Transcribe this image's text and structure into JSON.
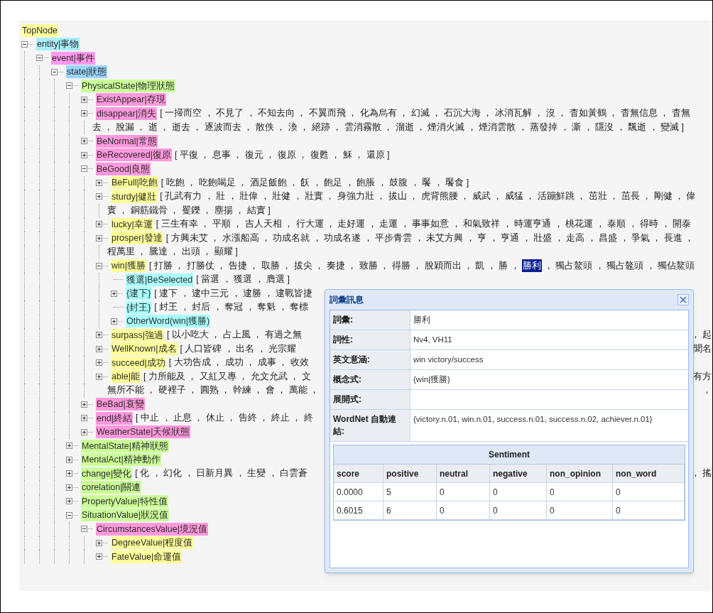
{
  "tree": {
    "label": "TopNode",
    "color": "#ffff99",
    "children": [
      {
        "label": "entity|事物",
        "color": "#a8f0ff",
        "expanded": true,
        "children": [
          {
            "label": "event|事件",
            "color": "#ff99ee",
            "expanded": true,
            "children": [
              {
                "label": "state|狀態",
                "color": "#99d6ff",
                "expanded": true,
                "children": [
                  {
                    "label": "PhysicalState|物理狀態",
                    "color": "#ccff99",
                    "expanded": true,
                    "children": [
                      {
                        "label": "ExistAppear|存現",
                        "color": "#ff99dd",
                        "expanded": false
                      },
                      {
                        "label": "disappear|消失",
                        "color": "#ff99dd",
                        "expanded": false,
                        "lines": [
                          "[ 一掃而空 ， 不見了 ， 不知去向 ， 不翼而飛 ， 化為烏有 ， 幻滅 ， 石沉大海 ， 冰消瓦解 ， 沒 ， 杳如黃鶴 ， 杳無信息 ， 杳無",
                          "去 ， 脫漏 ， 逝 ， 逝去 ， 逐波而去 ， 散佚 ， 渙 ， 絕跡 ， 雲消霧散 ， 溜逝 ， 煙消火滅 ， 煙消雲散 ， 蒸發掉 ， 澌 ， 隱沒 ， 飄逝 ， 變滅 ]"
                        ]
                      },
                      {
                        "label": "BeNormal|常態",
                        "color": "#ff99dd",
                        "expanded": false
                      },
                      {
                        "label": "BeRecovered|復原",
                        "color": "#ff99dd",
                        "expanded": false,
                        "lines": [
                          "[ 平復 ， 息事 ， 復元 ， 復原 ， 復甦 ， 穌 ， 還原 ]"
                        ]
                      },
                      {
                        "label": "BeGood|良態",
                        "color": "#ff99dd",
                        "expanded": true,
                        "children": [
                          {
                            "label": "BeFull|吃飽",
                            "color": "#ffff99",
                            "expanded": false,
                            "lines": [
                              "[ 吃飽 ， 吃飽喝足 ， 酒足飯飽 ， 飫 ， 飽足 ， 飽脹 ， 鼓腹 ， 饜 ， 饜食 ]"
                            ]
                          },
                          {
                            "label": "sturdy|健壯",
                            "color": "#ffff99",
                            "expanded": false,
                            "lines": [
                              "[ 孔武有力 ， 壯 ， 壯偉 ， 壯健 ， 壯實 ， 身強力壯 ， 拔山 ， 虎背熊腰 ， 威武 ， 威猛 ， 活蹦鮮跳 ， 茁壯 ， 茁長 ， 剛健 ， 偉",
                              "實 ， 銅筋鐵骨 ， 矍鑠 ， 塵揚 ， 結實 ]"
                            ]
                          },
                          {
                            "label": "lucky|幸運",
                            "color": "#ffff99",
                            "expanded": false,
                            "lines": [
                              "[ 三生有幸 ， 平順 ， 吉人天相 ， 行大運 ， 走好運 ， 走運 ， 事事如意 ， 和氣致祥 ， 時運亨通 ， 桃花運 ， 泰順 ， 得時 ， 開泰"
                            ]
                          },
                          {
                            "label": "prosper|發達",
                            "color": "#ffff99",
                            "expanded": false,
                            "lines": [
                              "[ 方興未艾 ， 水漲船高 ， 功成名就 ， 功成名遂 ， 平步青雲 ， 未艾方興 ， 亨 ， 亨通 ， 壯盛 ， 走高 ， 昌盛 ， 爭氣 ， 長進 ，",
                              "程萬里 ， 騰達 ， 出頭 ， 顯耀 ]"
                            ]
                          },
                          {
                            "label": "win|獲勝",
                            "color": "#ffff99",
                            "expanded": true,
                            "segments": [
                              {
                                "text": "[ 打勝 ， 打勝仗 ， 告捷 ， 取勝 ， 拔尖 ， 奏捷 ， 致勝 ， 得勝 ， 脫穎而出 ， 凱 ， 勝 ，",
                                "selected": false
                              },
                              {
                                "text": "勝利",
                                "selected": true
                              },
                              {
                                "text": "， 獨占鰲頭 ， 獨占鼇頭 ， 獨佔鰲頭",
                                "selected": false
                              }
                            ],
                            "children": [
                              {
                                "label": "獲選|BeSelected",
                                "color": "#aaffff",
                                "lines": [
                                  "[ 當選 ， 獲選 ， 膺選 ]"
                                ]
                              },
                              {
                                "label": "{逮下}",
                                "color": "#aaffff",
                                "expanded": false,
                                "lines": [
                                  "[ 逮下 ， 逮中三元 ， 逮勝 ， 逮戰皆捷"
                                ]
                              },
                              {
                                "label": "{封王}",
                                "color": "#aaffff",
                                "lines": [
                                  "[ 封王 ， 封后 ， 奪冠 ， 奪魁 ， 奪標"
                                ]
                              },
                              {
                                "label": "OtherWord(win|獲勝)",
                                "color": "#aaffff",
                                "expanded": false
                              }
                            ]
                          },
                          {
                            "label": "surpass|強過",
                            "color": "#ffff99",
                            "expanded": false,
                            "lines": [
                              "[ 以小吃大 ， 占上風 ， 有過之無"
                            ],
                            "tails": [
                              "， 起"
                            ]
                          },
                          {
                            "label": "WellKnown|成名",
                            "color": "#ffff99",
                            "expanded": false,
                            "lines": [
                              "[ 人口皆碑 ， 出名 ， 光宗耀"
                            ],
                            "tails": [
                              "聞名"
                            ]
                          },
                          {
                            "label": "succeed|成功",
                            "color": "#ffff99",
                            "expanded": false,
                            "lines": [
                              "[ 大功告成 ， 成功 ， 成事 ， 收效"
                            ]
                          },
                          {
                            "label": "able|能",
                            "color": "#ffff99",
                            "expanded": false,
                            "lines": [
                              "[ 力所能及 ， 又紅又專 ， 允文允武 ， 文",
                              "無所不能 ， 硬裡子 ， 圓熟 ， 幹練 ， 會 ， 萬能 ，"
                            ],
                            "tails": [
                              "有方",
                              "，"
                            ]
                          }
                        ]
                      },
                      {
                        "label": "BeBad|衰變",
                        "color": "#ff99dd",
                        "expanded": false
                      },
                      {
                        "label": "end|終結",
                        "color": "#ff99dd",
                        "expanded": false,
                        "lines": [
                          "[ 中止 ， 止息 ， 休止 ， 告終 ， 終止 ， 終"
                        ]
                      },
                      {
                        "label": "WeatherState|天候狀態",
                        "color": "#ff99dd",
                        "expanded": false
                      }
                    ]
                  },
                  {
                    "label": "MentalState|精神狀態",
                    "color": "#ccff99",
                    "expanded": false
                  },
                  {
                    "label": "MentalAct|精神動作",
                    "color": "#ccff99",
                    "expanded": false
                  },
                  {
                    "label": "change|變化",
                    "color": "#ccff99",
                    "expanded": false,
                    "lines": [
                      "[ 化 ， 幻化 ， 日新月異 ， 生變 ， 白雲蒼"
                    ],
                    "tails": [
                      "， 搖"
                    ]
                  },
                  {
                    "label": "corelation|關連",
                    "color": "#ccff99",
                    "expanded": false
                  },
                  {
                    "label": "PropertyValue|特性值",
                    "color": "#ccff99",
                    "expanded": false
                  },
                  {
                    "label": "SituationValue|狀況值",
                    "color": "#ccff99",
                    "expanded": true,
                    "children": [
                      {
                        "label": "CircumstancesValue|境況值",
                        "color": "#ff99dd",
                        "expanded": true,
                        "children": [
                          {
                            "label": "DegreeValue|程度值",
                            "color": "#ffff99",
                            "expanded": false
                          },
                          {
                            "label": "FateValue|命運值",
                            "color": "#ffff99",
                            "expanded": false
                          }
                        ]
                      }
                    ]
                  }
                ]
              }
            ]
          }
        ]
      }
    ]
  },
  "popup": {
    "title": "詞彙訊息",
    "fields": [
      {
        "label": "詞彙:",
        "value": "勝利"
      },
      {
        "label": "詞性:",
        "value": "Nv4, VH11"
      },
      {
        "label": "英文意涵:",
        "value": "win victory/success"
      },
      {
        "label": "概念式:",
        "value": "{win|獲勝}"
      },
      {
        "label": "展開式:"
      },
      {
        "label": "WordNet 自動連結:",
        "value": "{victory.n.01, win.n.01, success.n.01, success.n.02, achiever.n.01}"
      }
    ],
    "sentiment": {
      "title": "Sentiment",
      "columns": [
        "score",
        "positive",
        "neutral",
        "negative",
        "non_opinion",
        "non_word"
      ],
      "rows": [
        [
          "0.0000",
          "5",
          "0",
          "0",
          "0",
          "0"
        ],
        [
          "0.6015",
          "6",
          "0",
          "0",
          "0",
          "0"
        ]
      ]
    }
  }
}
